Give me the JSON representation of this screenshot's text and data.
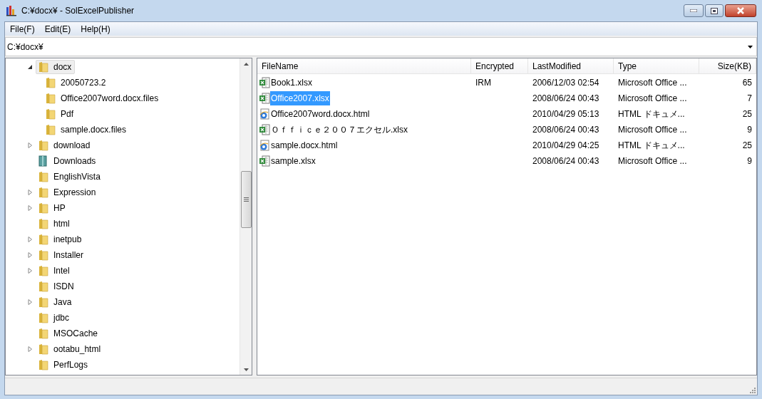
{
  "window": {
    "title": "C:¥docx¥ - SolExcelPublisher"
  },
  "menu": [
    "File(F)",
    "Edit(E)",
    "Help(H)"
  ],
  "address": {
    "value": "C:¥docx¥"
  },
  "tree": [
    {
      "label": "docx",
      "kind": "folder",
      "expanded": true,
      "selected": true,
      "children": [
        {
          "label": "20050723.2",
          "kind": "folder",
          "expanded": false,
          "selected": false
        },
        {
          "label": "Office2007word.docx.files",
          "kind": "folder",
          "expanded": false,
          "selected": false
        },
        {
          "label": "Pdf",
          "kind": "folder",
          "expanded": false,
          "selected": false
        },
        {
          "label": "sample.docx.files",
          "kind": "folder",
          "expanded": false,
          "selected": false
        }
      ]
    },
    {
      "label": "download",
      "kind": "folder",
      "expandable": true,
      "expanded": false,
      "selected": false
    },
    {
      "label": "Downloads",
      "kind": "special",
      "expanded": false,
      "selected": false
    },
    {
      "label": "EnglishVista",
      "kind": "folder",
      "expanded": false,
      "selected": false
    },
    {
      "label": "Expression",
      "kind": "folder",
      "expandable": true,
      "expanded": false,
      "selected": false
    },
    {
      "label": "HP",
      "kind": "folder",
      "expandable": true,
      "expanded": false,
      "selected": false
    },
    {
      "label": "html",
      "kind": "folder",
      "expanded": false,
      "selected": false
    },
    {
      "label": "inetpub",
      "kind": "folder",
      "expandable": true,
      "expanded": false,
      "selected": false
    },
    {
      "label": "Installer",
      "kind": "folder",
      "expandable": true,
      "expanded": false,
      "selected": false
    },
    {
      "label": "Intel",
      "kind": "folder",
      "expandable": true,
      "expanded": false,
      "selected": false
    },
    {
      "label": "ISDN",
      "kind": "folder",
      "expanded": false,
      "selected": false
    },
    {
      "label": "Java",
      "kind": "folder",
      "expandable": true,
      "expanded": false,
      "selected": false
    },
    {
      "label": "jdbc",
      "kind": "folder",
      "expanded": false,
      "selected": false
    },
    {
      "label": "MSOCache",
      "kind": "folder",
      "expanded": false,
      "selected": false
    },
    {
      "label": "ootabu_html",
      "kind": "folder",
      "expandable": true,
      "expanded": false,
      "selected": false
    },
    {
      "label": "PerfLogs",
      "kind": "folder",
      "expanded": false,
      "selected": false
    }
  ],
  "table": {
    "columns": [
      "FileName",
      "Encrypted",
      "LastModified",
      "Type",
      "Size(KB)"
    ],
    "rows": [
      {
        "kind": "excel",
        "selected": false,
        "cells": [
          "Book1.xlsx",
          "IRM",
          "2006/12/03 02:54",
          "Microsoft Office ...",
          "65"
        ]
      },
      {
        "kind": "excel",
        "selected": true,
        "cells": [
          "Office2007.xlsx",
          "",
          "2008/06/24 00:43",
          "Microsoft Office ...",
          "7"
        ]
      },
      {
        "kind": "html",
        "selected": false,
        "cells": [
          "Office2007word.docx.html",
          "",
          "2010/04/29 05:13",
          "HTML ドキュメ...",
          "25"
        ]
      },
      {
        "kind": "excel",
        "selected": false,
        "cells": [
          "Ｏｆｆｉｃｅ２００７エクセル.xlsx",
          "",
          "2008/06/24 00:43",
          "Microsoft Office ...",
          "9"
        ]
      },
      {
        "kind": "html",
        "selected": false,
        "cells": [
          "sample.docx.html",
          "",
          "2010/04/29 04:25",
          "HTML ドキュメ...",
          "25"
        ]
      },
      {
        "kind": "excel",
        "selected": false,
        "cells": [
          "sample.xlsx",
          "",
          "2008/06/24 00:43",
          "Microsoft Office ...",
          "9"
        ]
      }
    ]
  }
}
